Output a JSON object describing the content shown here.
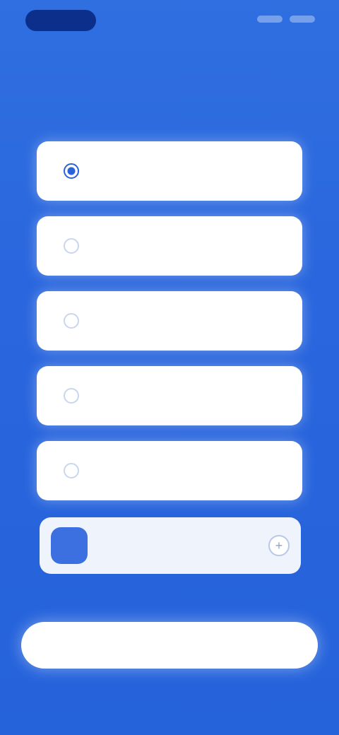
{
  "status_bar": {
    "time": ""
  },
  "header": {
    "title": "",
    "subtitle": ""
  },
  "options": [
    {
      "label": "",
      "selected": true
    },
    {
      "label": "",
      "selected": false
    },
    {
      "label": "",
      "selected": false
    },
    {
      "label": "",
      "selected": false
    },
    {
      "label": "",
      "selected": false
    }
  ],
  "custom": {
    "placeholder": "",
    "add_icon": "plus-icon"
  },
  "primary_button": {
    "label": ""
  },
  "colors": {
    "background": "#2a66de",
    "accent": "#2a62d9",
    "card": "#ffffff"
  }
}
